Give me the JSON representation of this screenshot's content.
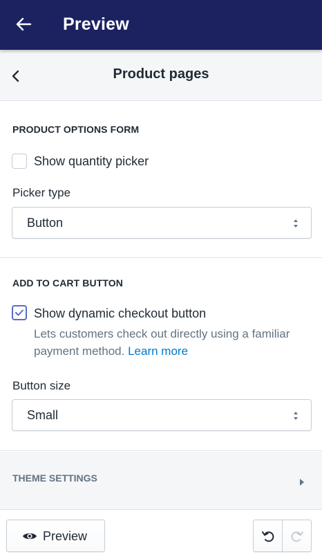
{
  "header": {
    "title": "Preview",
    "back_icon": "arrow-left-icon",
    "background": "#1c2260"
  },
  "subheader": {
    "title": "Product pages",
    "back_icon": "chevron-left-icon"
  },
  "product_options": {
    "heading": "PRODUCT OPTIONS FORM",
    "show_quantity_picker": {
      "label": "Show quantity picker",
      "checked": false
    },
    "picker_type": {
      "label": "Picker type",
      "value": "Button"
    }
  },
  "add_to_cart": {
    "heading": "ADD TO CART BUTTON",
    "show_dynamic_checkout": {
      "label": "Show dynamic checkout button",
      "checked": true,
      "help": "Lets customers check out directly using a familiar payment method.",
      "link": "Learn more"
    },
    "button_size": {
      "label": "Button size",
      "value": "Small"
    }
  },
  "theme_settings": {
    "label": "THEME SETTINGS"
  },
  "footer": {
    "preview_label": "Preview",
    "preview_icon": "eye-icon",
    "undo_icon": "undo-icon",
    "redo_icon": "redo-icon"
  },
  "colors": {
    "accent": "#5c6ac4",
    "link": "#007ace",
    "muted_text": "#637381"
  }
}
